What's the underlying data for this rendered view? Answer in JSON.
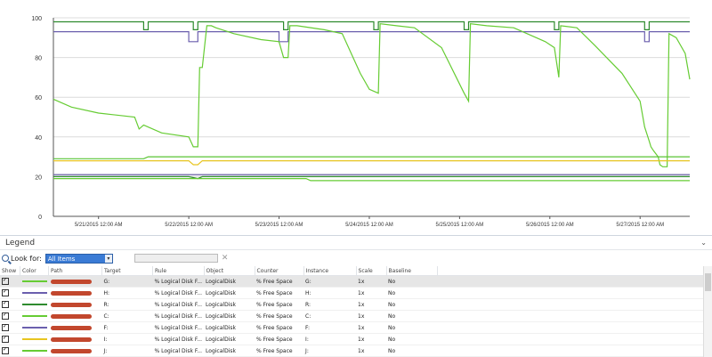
{
  "chart_data": {
    "type": "line",
    "y_ticks": [
      "0",
      "20",
      "40",
      "60",
      "80",
      "100"
    ],
    "ylim": [
      0,
      100
    ],
    "x_labels": [
      "5/21/2015 12:00 AM",
      "5/22/2015 12:00 AM",
      "5/23/2015 12:00 AM",
      "5/24/2015 12:00 AM",
      "5/25/2015 12:00 AM",
      "5/26/2015 12:00 AM",
      "5/27/2015 12:00 AM"
    ],
    "x_label_positions": [
      0.5,
      1.5,
      2.5,
      3.5,
      4.5,
      5.5,
      6.5
    ],
    "xlim": [
      0,
      7.05
    ],
    "grid": true,
    "series": [
      {
        "color": "#2e8b2e",
        "points": [
          [
            0,
            98
          ],
          [
            1.0,
            98
          ],
          [
            1.0,
            94
          ],
          [
            1.05,
            94
          ],
          [
            1.05,
            98
          ],
          [
            1.55,
            98
          ],
          [
            1.55,
            94
          ],
          [
            1.6,
            94
          ],
          [
            1.6,
            98
          ],
          [
            2.55,
            98
          ],
          [
            2.55,
            94
          ],
          [
            2.6,
            94
          ],
          [
            2.6,
            98
          ],
          [
            3.55,
            98
          ],
          [
            3.55,
            94
          ],
          [
            3.6,
            94
          ],
          [
            3.6,
            98
          ],
          [
            4.55,
            98
          ],
          [
            4.55,
            94
          ],
          [
            4.6,
            94
          ],
          [
            4.6,
            98
          ],
          [
            5.55,
            98
          ],
          [
            5.55,
            94
          ],
          [
            5.6,
            94
          ],
          [
            5.6,
            98
          ],
          [
            6.55,
            98
          ],
          [
            6.55,
            94
          ],
          [
            6.6,
            94
          ],
          [
            6.6,
            98
          ],
          [
            7.05,
            98
          ]
        ]
      },
      {
        "color": "#6b5fae",
        "points": [
          [
            0,
            93
          ],
          [
            1.5,
            93
          ],
          [
            1.5,
            88
          ],
          [
            1.6,
            88
          ],
          [
            1.6,
            93
          ],
          [
            2.5,
            93
          ],
          [
            2.5,
            88
          ],
          [
            2.6,
            88
          ],
          [
            2.6,
            93
          ],
          [
            6.55,
            93
          ],
          [
            6.55,
            88
          ],
          [
            6.6,
            88
          ],
          [
            6.6,
            93
          ],
          [
            7.05,
            93
          ]
        ]
      },
      {
        "color": "#66cc33",
        "points": [
          [
            0,
            59
          ],
          [
            0.2,
            55
          ],
          [
            0.5,
            52
          ],
          [
            0.9,
            50
          ],
          [
            0.95,
            44
          ],
          [
            1.0,
            46
          ],
          [
            1.2,
            42
          ],
          [
            1.5,
            40
          ],
          [
            1.55,
            35
          ],
          [
            1.6,
            35
          ],
          [
            1.62,
            75
          ],
          [
            1.65,
            75
          ],
          [
            1.7,
            96
          ],
          [
            1.75,
            96
          ],
          [
            1.8,
            95
          ],
          [
            2.0,
            92
          ],
          [
            2.3,
            89
          ],
          [
            2.5,
            88
          ],
          [
            2.55,
            80
          ],
          [
            2.6,
            80
          ],
          [
            2.62,
            96
          ],
          [
            2.7,
            96
          ],
          [
            3.0,
            94
          ],
          [
            3.2,
            92
          ],
          [
            3.4,
            72
          ],
          [
            3.5,
            64
          ],
          [
            3.6,
            62
          ],
          [
            3.62,
            97
          ],
          [
            3.8,
            96
          ],
          [
            4.0,
            95
          ],
          [
            4.3,
            85
          ],
          [
            4.55,
            62
          ],
          [
            4.6,
            58
          ],
          [
            4.62,
            97
          ],
          [
            4.8,
            96
          ],
          [
            5.1,
            95
          ],
          [
            5.45,
            88
          ],
          [
            5.55,
            85
          ],
          [
            5.6,
            70
          ],
          [
            5.62,
            96
          ],
          [
            5.8,
            95
          ],
          [
            6.0,
            86
          ],
          [
            6.3,
            72
          ],
          [
            6.5,
            58
          ],
          [
            6.55,
            45
          ],
          [
            6.6,
            38
          ],
          [
            6.62,
            35
          ],
          [
            6.65,
            33
          ],
          [
            6.7,
            30
          ],
          [
            6.72,
            26
          ],
          [
            6.75,
            25
          ],
          [
            6.8,
            25
          ],
          [
            6.82,
            92
          ],
          [
            6.9,
            90
          ],
          [
            7.0,
            82
          ],
          [
            7.05,
            69
          ]
        ]
      },
      {
        "color": "#59c433",
        "points": [
          [
            0,
            29
          ],
          [
            1.0,
            29
          ],
          [
            1.05,
            30
          ],
          [
            7.05,
            30
          ]
        ]
      },
      {
        "color": "#e8c520",
        "points": [
          [
            0,
            28
          ],
          [
            1.5,
            28
          ],
          [
            1.55,
            26
          ],
          [
            1.6,
            26
          ],
          [
            1.65,
            28
          ],
          [
            7.05,
            28
          ]
        ]
      },
      {
        "color": "#9a9a9a",
        "points": [
          [
            0,
            21
          ],
          [
            7.05,
            21
          ]
        ]
      },
      {
        "color": "#2e8b2e",
        "points": [
          [
            0,
            20
          ],
          [
            1.5,
            20
          ],
          [
            1.6,
            19
          ],
          [
            1.65,
            20
          ],
          [
            7.05,
            20
          ]
        ]
      },
      {
        "color": "#6b5fae",
        "points": [
          [
            0,
            21
          ],
          [
            7.05,
            21
          ]
        ]
      },
      {
        "color": "#66cc33",
        "points": [
          [
            0,
            19
          ],
          [
            2.8,
            19
          ],
          [
            2.85,
            18
          ],
          [
            7.05,
            18
          ]
        ]
      }
    ]
  },
  "legend": {
    "title": "Legend",
    "collapse_icon": "chevron-down-icon",
    "lookfor_label": "Look for:",
    "lookfor_value": "All Items",
    "columns": [
      "Show",
      "Color",
      "Path",
      "Target",
      "Rule",
      "Object",
      "Counter",
      "Instance",
      "Scale",
      "Baseline"
    ],
    "rows": [
      {
        "color": "#66cc33",
        "target": "G:",
        "rule": "% Logical Disk F...",
        "object": "LogicalDisk",
        "counter": "% Free Space",
        "instance": "G:",
        "scale": "1x",
        "baseline": "No",
        "selected": true
      },
      {
        "color": "#6b5fae",
        "target": "H:",
        "rule": "% Logical Disk F...",
        "object": "LogicalDisk",
        "counter": "% Free Space",
        "instance": "H:",
        "scale": "1x",
        "baseline": "No"
      },
      {
        "color": "#2e8b2e",
        "target": "R:",
        "rule": "% Logical Disk F...",
        "object": "LogicalDisk",
        "counter": "% Free Space",
        "instance": "R:",
        "scale": "1x",
        "baseline": "No"
      },
      {
        "color": "#66cc33",
        "target": "C:",
        "rule": "% Logical Disk F...",
        "object": "LogicalDisk",
        "counter": "% Free Space",
        "instance": "C:",
        "scale": "1x",
        "baseline": "No"
      },
      {
        "color": "#6b5fae",
        "target": "F:",
        "rule": "% Logical Disk F...",
        "object": "LogicalDisk",
        "counter": "% Free Space",
        "instance": "F:",
        "scale": "1x",
        "baseline": "No"
      },
      {
        "color": "#e8c520",
        "target": "I:",
        "rule": "% Logical Disk F...",
        "object": "LogicalDisk",
        "counter": "% Free Space",
        "instance": "I:",
        "scale": "1x",
        "baseline": "No"
      },
      {
        "color": "#66cc33",
        "target": "J:",
        "rule": "% Logical Disk F...",
        "object": "LogicalDisk",
        "counter": "% Free Space",
        "instance": "J:",
        "scale": "1x",
        "baseline": "No"
      }
    ]
  }
}
